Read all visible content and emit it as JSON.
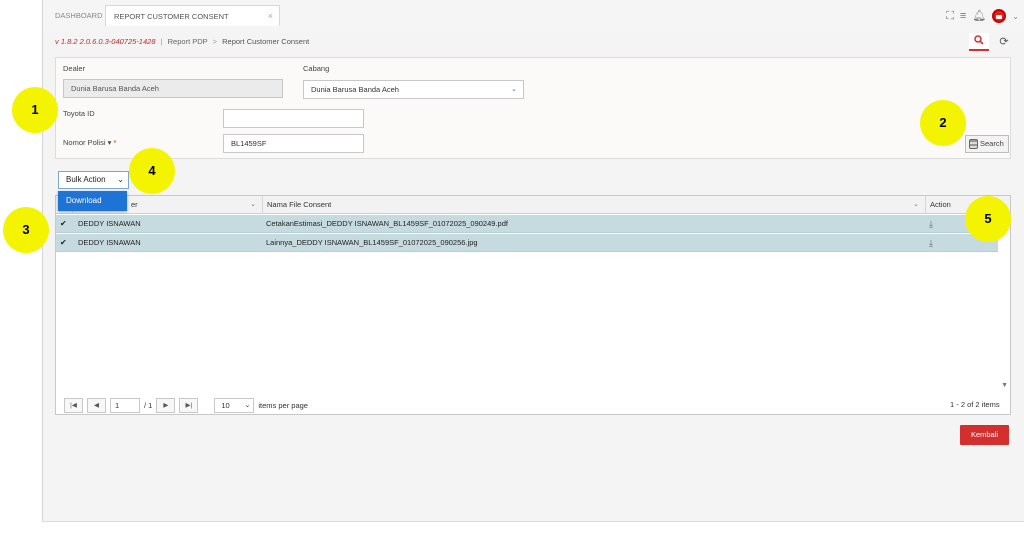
{
  "tabs": {
    "dashboard": "DASHBOARD",
    "report": "REPORT CUSTOMER CONSENT",
    "close": "×"
  },
  "header_icons": [
    "expand-icon",
    "menu-icon",
    "bell-icon",
    "avatar",
    "chevron-down-icon"
  ],
  "breadcrumb": {
    "version": "v 1.8.2 2.0.6.0.3-040725-1428",
    "separator_1": "|",
    "parent": "Report PDP",
    "separator_2": ">",
    "current": "Report Customer Consent"
  },
  "filter": {
    "dealer_label": "Dealer",
    "dealer_value": "Dunia Barusa Banda Aceh",
    "cabang_label": "Cabang",
    "cabang_value": "Dunia Barusa Banda Aceh",
    "toyota_id_label": "Toyota ID",
    "toyota_id_value": "",
    "nomor_polisi_label": "Nomor Polisi",
    "nomor_polisi_dropdown": "▾",
    "required_mark": "*",
    "nomor_polisi_value": "BL1459SF",
    "search_button": "Search"
  },
  "bulk_action": {
    "label": "Bulk Action",
    "options": [
      "Download"
    ]
  },
  "grid": {
    "columns": [
      "er",
      "Nama File Consent",
      "Action"
    ],
    "rows": [
      {
        "checked": true,
        "name": "DEDDY ISNAWAN",
        "file": "CetakanEstimasi_DEDDY ISNAWAN_BL1459SF_01072025_090249.pdf"
      },
      {
        "checked": true,
        "name": "DEDDY ISNAWAN",
        "file": "Lainnya_DEDDY ISNAWAN_BL1459SF_01072025_090256.jpg"
      }
    ]
  },
  "pager": {
    "page": "1",
    "of_label": "/ 1",
    "page_size": "10",
    "per_page_label": "items per page",
    "info": "1 - 2 of 2 items"
  },
  "kembali_button": "Kembali",
  "markers": [
    "1",
    "2",
    "3",
    "4",
    "5"
  ],
  "colors": {
    "accent_red": "#d32f2f",
    "selected_row": "#c6dbe0",
    "dropdown_blue": "#1e73d6",
    "marker_yellow": "#f4f400"
  }
}
